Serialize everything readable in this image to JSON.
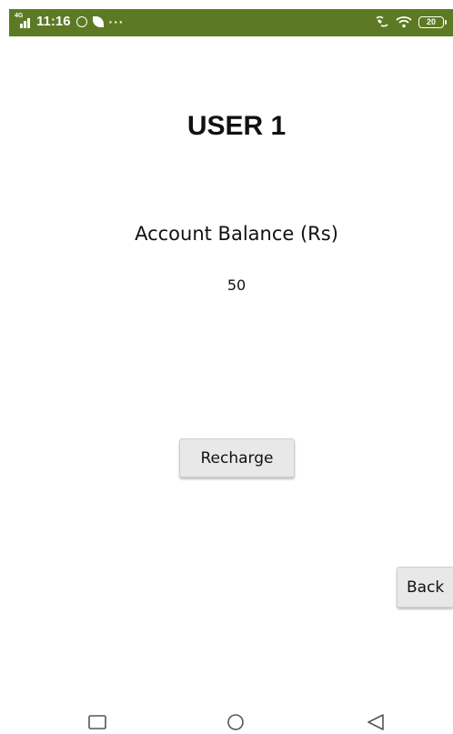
{
  "status_bar": {
    "network_label": "4G",
    "time": "11:16",
    "more": "···",
    "battery_level": "20",
    "background_color": "#5c7a23"
  },
  "main": {
    "title": "USER 1",
    "balance_label": "Account Balance (Rs)",
    "balance_value": "50",
    "recharge_label": "Recharge",
    "back_label": "Back"
  },
  "nav_bar": {
    "icons": [
      "recent-apps-square-icon",
      "home-circle-icon",
      "back-triangle-icon"
    ],
    "icon_color": "#555555"
  }
}
